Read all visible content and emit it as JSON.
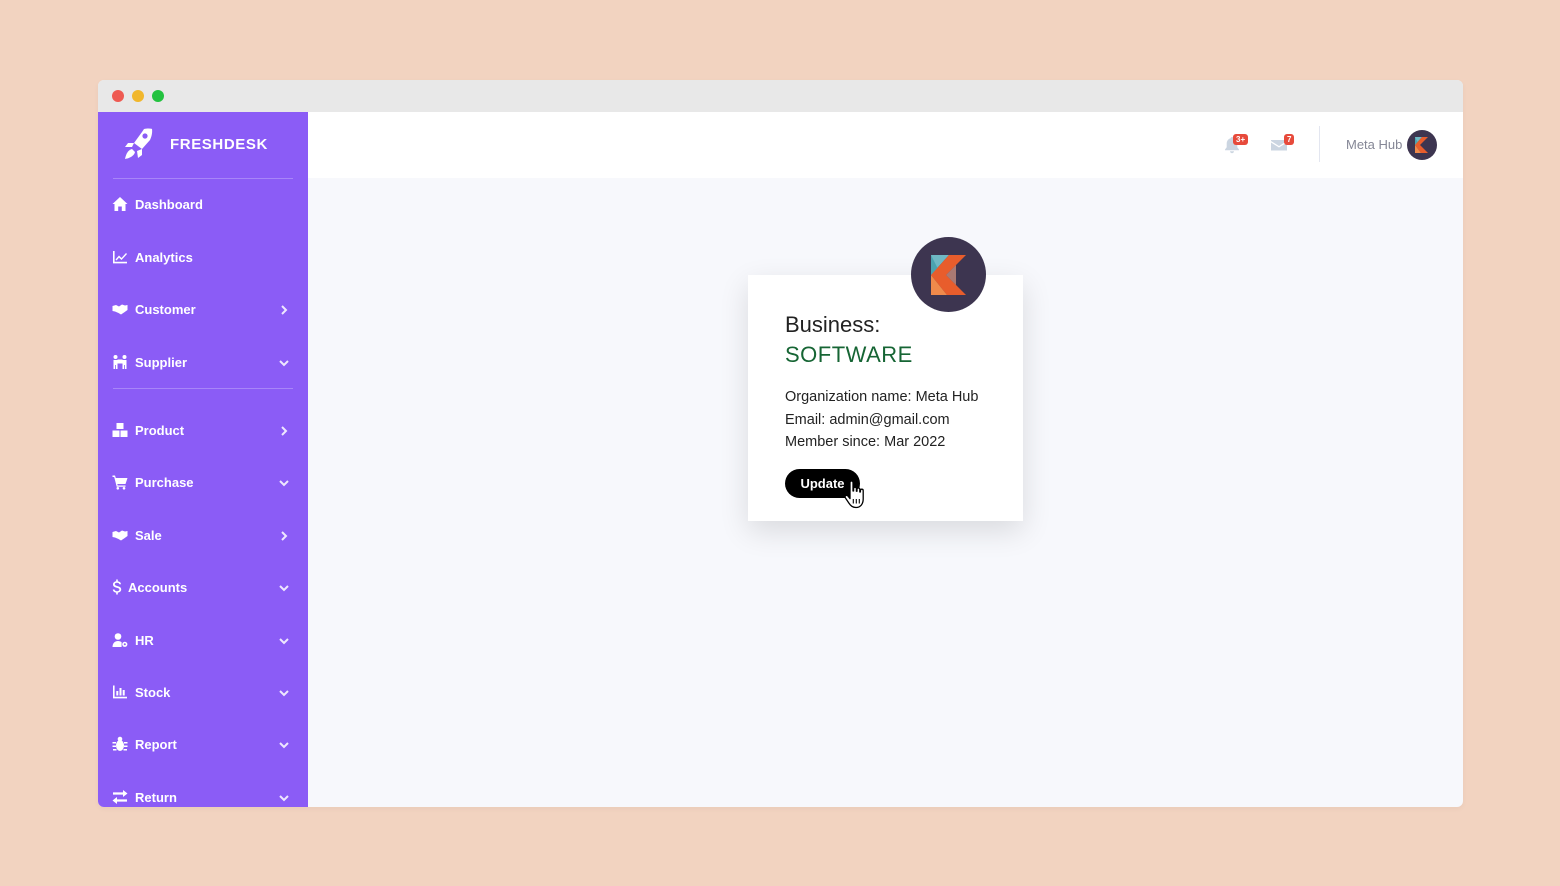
{
  "brand": {
    "name": "FRESHDESK",
    "logo_icon": "rocket-icon"
  },
  "header": {
    "notifications": {
      "icon": "bell-icon",
      "badge": "3+"
    },
    "messages": {
      "icon": "envelope-icon",
      "badge": "7"
    },
    "user_name": "Meta Hub"
  },
  "sidebar": {
    "items": [
      {
        "label": "Dashboard",
        "icon": "home-icon"
      },
      {
        "label": "Analytics",
        "icon": "chart-line-icon"
      },
      {
        "label": "Customer",
        "icon": "handshake-icon",
        "chevron": "right"
      },
      {
        "label": "Supplier",
        "icon": "people-carry-icon",
        "chevron": "down"
      },
      {
        "label": "Product",
        "icon": "boxes-icon",
        "chevron": "right"
      },
      {
        "label": "Purchase",
        "icon": "cart-icon",
        "chevron": "down"
      },
      {
        "label": "Sale",
        "icon": "handshake-icon",
        "chevron": "right"
      },
      {
        "label": "Accounts",
        "icon": "dollar-icon",
        "chevron": "down"
      },
      {
        "label": "HR",
        "icon": "user-cog-icon",
        "chevron": "down"
      },
      {
        "label": "Stock",
        "icon": "bar-chart-icon",
        "chevron": "down"
      },
      {
        "label": "Report",
        "icon": "bug-icon",
        "chevron": "down"
      },
      {
        "label": "Return",
        "icon": "exchange-icon",
        "chevron": "down"
      }
    ]
  },
  "profile_card": {
    "business_label": "Business:",
    "business_value": "SOFTWARE",
    "organization": "Organization name: Meta Hub",
    "email": "Email: admin@gmail.com",
    "member_since": "Member since: Mar 2022",
    "update_label": "Update"
  },
  "colors": {
    "page_bg": "#f2d3c0",
    "sidebar_bg": "#8b5cf6",
    "accent_green": "#166534",
    "badge_red": "#e74a3b"
  }
}
